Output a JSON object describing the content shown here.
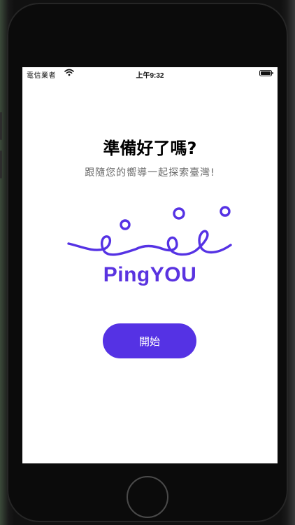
{
  "status_bar": {
    "carrier": "電信業者",
    "time": "上午9:32",
    "wifi_icon": "wifi-icon",
    "battery_icon": "battery-icon"
  },
  "main": {
    "title": "準備好了嗎?",
    "subtitle": "跟隨您的嚮導一起探索臺灣!",
    "logo_text": "PingYOU",
    "start_button_label": "開始"
  },
  "colors": {
    "brand": "#5532E4",
    "background": "#FFFFFF"
  }
}
